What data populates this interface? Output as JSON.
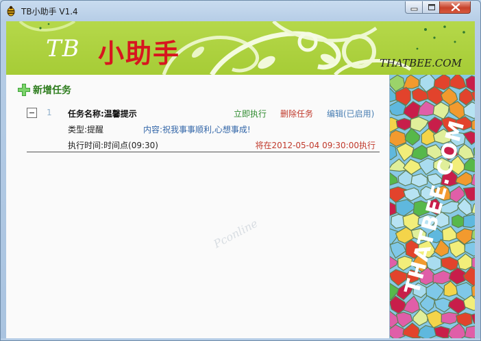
{
  "window": {
    "title": "TB小助手 V1.4",
    "controls": {
      "minimize": "minimize-icon",
      "maximize": "maximize-icon",
      "close": "close-icon"
    }
  },
  "banner": {
    "logo_latin": "TB",
    "logo_cn": "小助手",
    "domain": "THATBEE.COM",
    "colors": {
      "background": "#a6cc36",
      "logo_red": "#d7161f"
    }
  },
  "toolbar": {
    "add_task_label": "新增任务",
    "add_task_icon": "plus-icon"
  },
  "tasks": [
    {
      "index": "1",
      "name": "任务名称:温馨提示",
      "actions": {
        "run": "立即执行",
        "delete": "删除任务",
        "edit": "编辑(已启用)"
      },
      "type": "类型:提醒",
      "content": "内容:祝我事事顺利,心想事成!",
      "time": "执行时间:时间点(09:30)",
      "next_run": "将在2012-05-04 09:30:00执行"
    }
  ],
  "watermark": "Pconline",
  "side_panel": {
    "text": "THATBEE.COM"
  }
}
